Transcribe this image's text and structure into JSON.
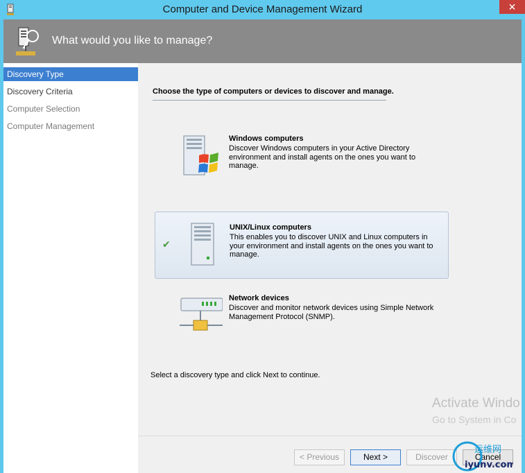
{
  "window": {
    "title": "Computer and Device Management Wizard",
    "close_glyph": "✕"
  },
  "header": {
    "title": "What would you like to manage?",
    "icon": "wizard-header-icon"
  },
  "sidebar": {
    "items": [
      {
        "label": "Discovery Type",
        "state": "active"
      },
      {
        "label": "Discovery Criteria",
        "state": "done"
      },
      {
        "label": "Computer Selection",
        "state": "pending"
      },
      {
        "label": "Computer Management",
        "state": "pending"
      }
    ]
  },
  "main": {
    "instruction": "Choose the type of computers or devices to discover and manage.",
    "options": [
      {
        "title": "Windows computers",
        "description": "Discover Windows computers in your Active Directory environment and install agents on the ones you want to manage.",
        "selected": false,
        "icon": "windows-server-icon"
      },
      {
        "title": "UNIX/Linux computers",
        "description": "This enables you to discover UNIX and Linux computers in your environment and install agents on the ones you want to manage.",
        "selected": true,
        "icon": "unix-server-icon"
      },
      {
        "title": "Network devices",
        "description": "Discover and monitor network devices using Simple Network Management Protocol (SNMP).",
        "selected": false,
        "icon": "network-device-icon"
      }
    ],
    "hint": "Select a discovery type and click Next to continue."
  },
  "buttons": {
    "previous": "< Previous",
    "next": "Next >",
    "discover": "Discover",
    "cancel": "Cancel"
  },
  "watermark": {
    "line1": "Activate Windo",
    "line2": "Go to System in Co",
    "logo_text": "运维网",
    "logo_domain": "iyunv.com"
  },
  "colors": {
    "titlebar": "#60c9ee",
    "header": "#8a8a8a",
    "sidebar_active": "#3c7fd0",
    "close": "#c7403a"
  }
}
